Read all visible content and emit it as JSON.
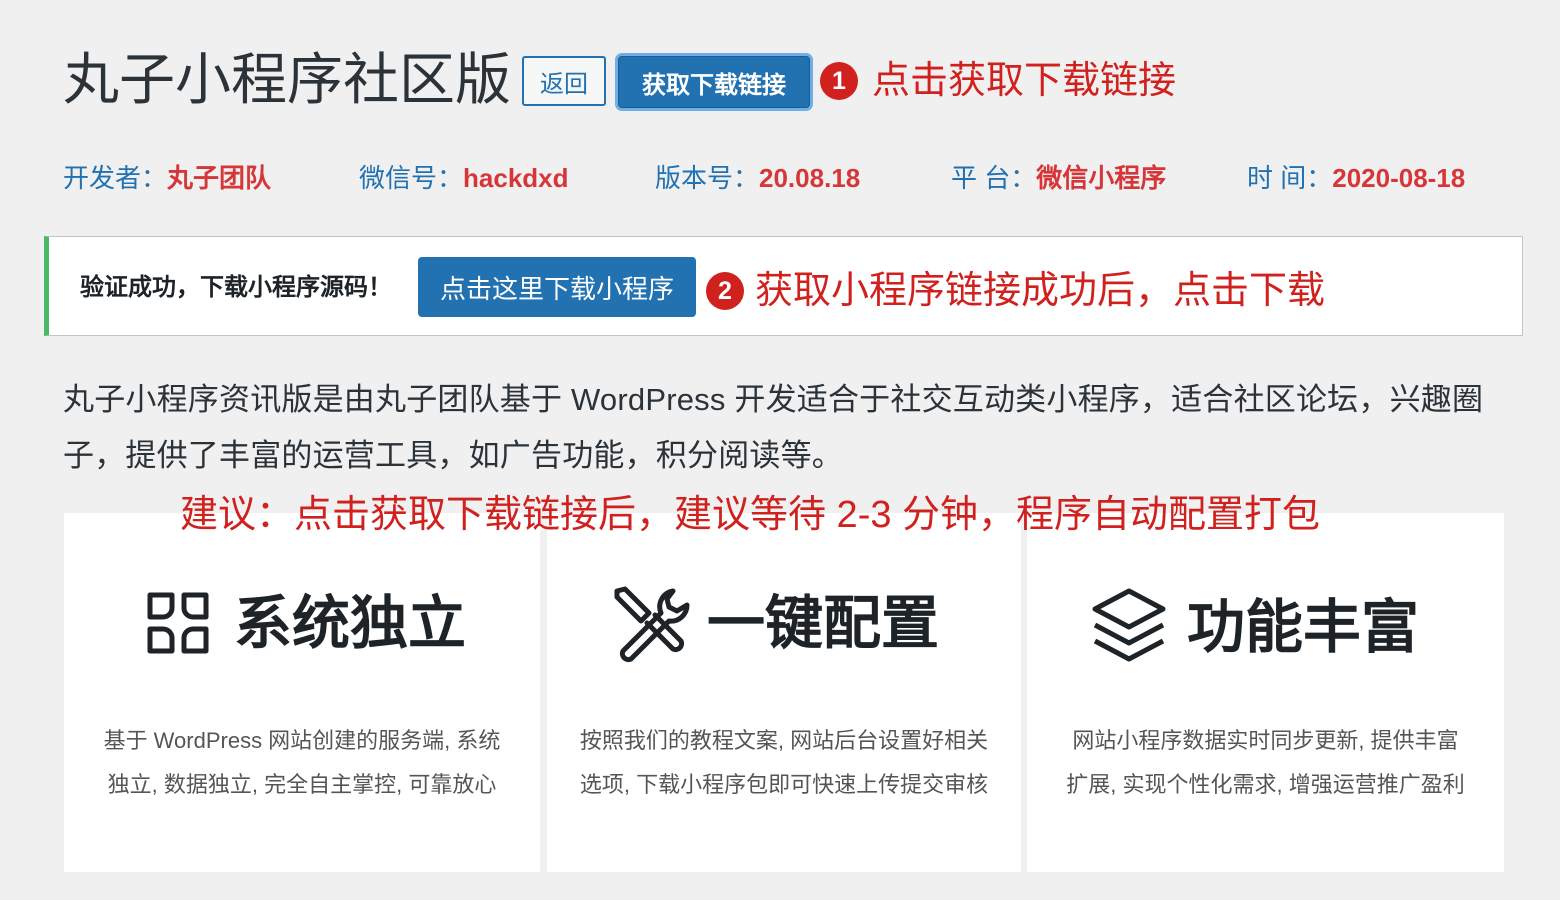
{
  "header": {
    "title": "丸子小程序社区版",
    "back_label": "返回",
    "get_link_label": "获取下载链接"
  },
  "annotations": {
    "step1_number": "1",
    "step1_text": "点击获取下载链接",
    "step2_number": "2",
    "step2_text": "获取小程序链接成功后，点击下载",
    "suggestion": "建议：点击获取下载链接后，建议等待 2-3 分钟，程序自动配置打包"
  },
  "meta": [
    {
      "key": "开发者：",
      "value": "丸子团队"
    },
    {
      "key": "微信号：",
      "value": "hackdxd"
    },
    {
      "key": "版本号：",
      "value": "20.08.18"
    },
    {
      "key": "平 台：",
      "value": "微信小程序"
    },
    {
      "key": "时 间：",
      "value": "2020-08-18"
    }
  ],
  "notice": {
    "text": "验证成功，下载小程序源码！",
    "button_label": "点击这里下载小程序"
  },
  "description": "丸子小程序资讯版是由丸子团队基于 WordPress 开发适合于社交互动类小程序，适合社区论坛，兴趣圈子，提供了丰富的运营工具，如广告功能，积分阅读等。",
  "features": [
    {
      "icon": "grid-icon",
      "title": "系统独立",
      "desc_line1": "基于 WordPress 网站创建的服务端, 系统",
      "desc_line2": "独立, 数据独立, 完全自主掌控, 可靠放心"
    },
    {
      "icon": "tools-icon",
      "title": "一键配置",
      "desc_line1": "按照我们的教程文案, 网站后台设置好相关",
      "desc_line2": "选项, 下载小程序包即可快速上传提交审核"
    },
    {
      "icon": "layers-icon",
      "title": "功能丰富",
      "desc_line1": "网站小程序数据实时同步更新, 提供丰富",
      "desc_line2": "扩展, 实现个性化需求, 增强运营推广盈利"
    }
  ]
}
